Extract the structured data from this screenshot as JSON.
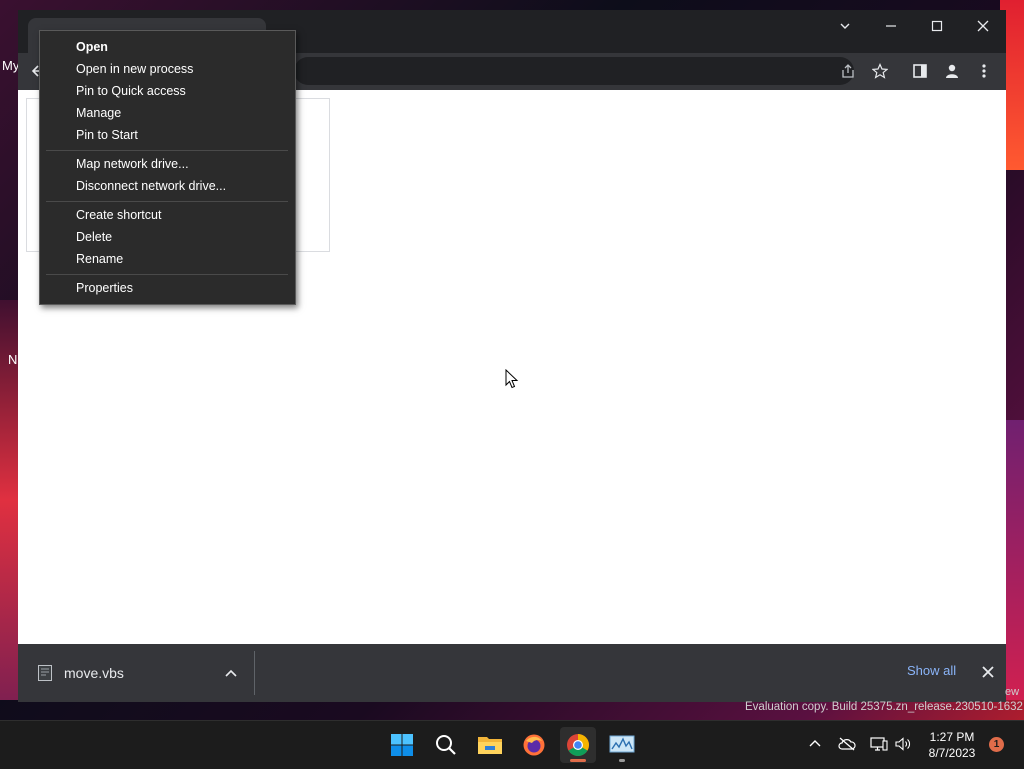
{
  "desktop": {
    "label_my": "My",
    "label_n": "N"
  },
  "context_menu": {
    "items": [
      {
        "label": "Open",
        "bold": true
      },
      {
        "label": "Open in new process"
      },
      {
        "label": "Pin to Quick access"
      },
      {
        "label": "Manage"
      },
      {
        "label": "Pin to Start"
      },
      {
        "label": "Map network drive..."
      },
      {
        "label": "Disconnect network drive..."
      },
      {
        "label": "Create shortcut"
      },
      {
        "label": "Delete"
      },
      {
        "label": "Rename"
      },
      {
        "label": "Properties"
      }
    ]
  },
  "download_bar": {
    "file_name": "move.vbs",
    "show_all": "Show all"
  },
  "watermark": "Evaluation copy. Build 25375.zn_release.230510-1632",
  "watermark_edge": "ew",
  "taskbar": {
    "apps": [
      {
        "name": "start-icon"
      },
      {
        "name": "search-icon"
      },
      {
        "name": "file-explorer-icon"
      },
      {
        "name": "firefox-icon"
      },
      {
        "name": "chrome-icon",
        "active": true
      },
      {
        "name": "resource-monitor-icon"
      }
    ],
    "clock": {
      "time": "1:27 PM",
      "date": "8/7/2023"
    },
    "notification_count": "1"
  },
  "colors": {
    "accent_blue": "#8ab4f8",
    "chrome_indicator": "#e06c4a"
  }
}
